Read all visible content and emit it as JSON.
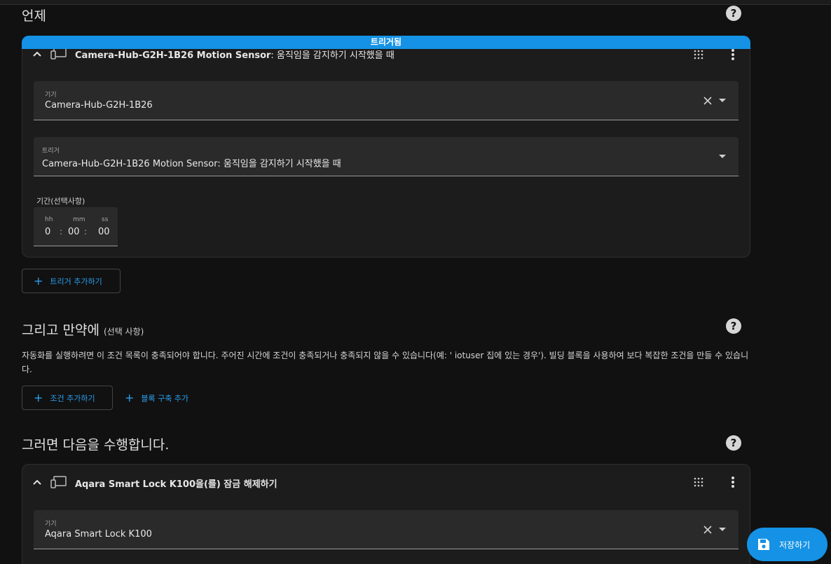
{
  "sections": {
    "when": {
      "title": "언제"
    },
    "and_if": {
      "title": "그리고 만약에",
      "subtitle": "(선택 사항)",
      "description": "자동화를 실행하려면 이 조건 목록이 충족되어야 합니다. 주어진 시간에 조건이 충족되거나 충족되지 않을 수 있습니다(예: ' iotuser 집에 있는 경우'). 빌딩 블록을 사용하여 보다 복잡한 조건을 만들 수 있습니다."
    },
    "then_do": {
      "title": "그러면 다음을 수행합니다."
    }
  },
  "trigger_card": {
    "banner": "트리거됨",
    "title_bold": "Camera-Hub-G2H-1B26 Motion Sensor",
    "title_rest": ": 움직임을 감지하기 시작했을 때",
    "device_field": {
      "label": "기기",
      "value": "Camera-Hub-G2H-1B26"
    },
    "trigger_field": {
      "label": "트리거",
      "value": "Camera-Hub-G2H-1B26 Motion Sensor: 움직임을 감지하기 시작했을 때"
    },
    "duration": {
      "label": "기간(선택사항)",
      "hh_label": "hh",
      "mm_label": "mm",
      "ss_label": "ss",
      "hh": "0",
      "mm": "00",
      "ss": "00",
      "sep": ":"
    }
  },
  "buttons": {
    "add_trigger": "트리거 추가하기",
    "add_condition": "조건 추가하기",
    "add_building_block": "블록 구축 추가",
    "save": "저장하기"
  },
  "action_card": {
    "title": "Aqara Smart Lock K100을(를) 잠금 해제하기",
    "device_field": {
      "label": "기기",
      "value": "Aqara Smart Lock K100"
    }
  },
  "colors": {
    "accent": "#1592e5",
    "link": "#2aa0ee",
    "background": "#111111",
    "card": "#1c1c1c"
  }
}
